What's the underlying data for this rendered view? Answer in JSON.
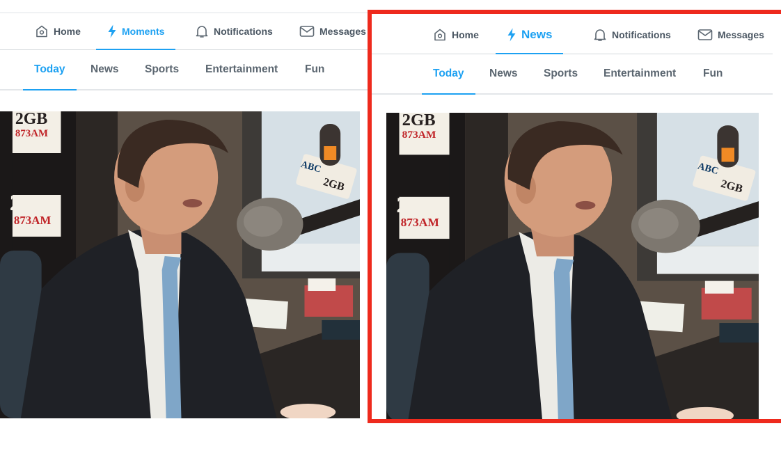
{
  "left_screen": {
    "topnav": [
      {
        "label": "Home",
        "icon": "home-icon",
        "active": false
      },
      {
        "label": "Moments",
        "icon": "lightning-icon",
        "active": true
      },
      {
        "label": "Notifications",
        "icon": "bell-icon",
        "active": false
      },
      {
        "label": "Messages",
        "icon": "envelope-icon",
        "active": false
      }
    ],
    "tabs": [
      {
        "label": "Today",
        "active": true
      },
      {
        "label": "News",
        "active": false
      },
      {
        "label": "Sports",
        "active": false
      },
      {
        "label": "Entertainment",
        "active": false
      },
      {
        "label": "Fun",
        "active": false
      }
    ],
    "photo": {
      "wall_text_top": "2GB",
      "wall_sub_top": "873AM",
      "wall_text": "2GB",
      "wall_sub": "873AM",
      "mic_flag_top": "ABC",
      "mic_flag_bottom": "2GB"
    }
  },
  "right_screen": {
    "topnav": [
      {
        "label": "Home",
        "icon": "home-icon",
        "active": false
      },
      {
        "label": "News",
        "icon": "lightning-icon",
        "active": true
      },
      {
        "label": "Notifications",
        "icon": "bell-icon",
        "active": false
      },
      {
        "label": "Messages",
        "icon": "envelope-icon",
        "active": false
      }
    ],
    "tabs": [
      {
        "label": "Today",
        "active": true
      },
      {
        "label": "News",
        "active": false
      },
      {
        "label": "Sports",
        "active": false
      },
      {
        "label": "Entertainment",
        "active": false
      },
      {
        "label": "Fun",
        "active": false
      }
    ],
    "photo": {
      "wall_text_top": "2GB",
      "wall_sub_top": "873AM",
      "wall_text": "2GB",
      "wall_sub": "873AM",
      "mic_flag_top": "ABC",
      "mic_flag_bottom": "2GB"
    }
  },
  "colors": {
    "accent": "#1da1f2",
    "highlight_border": "#ee2a1d",
    "nav_text": "#4a5662"
  }
}
